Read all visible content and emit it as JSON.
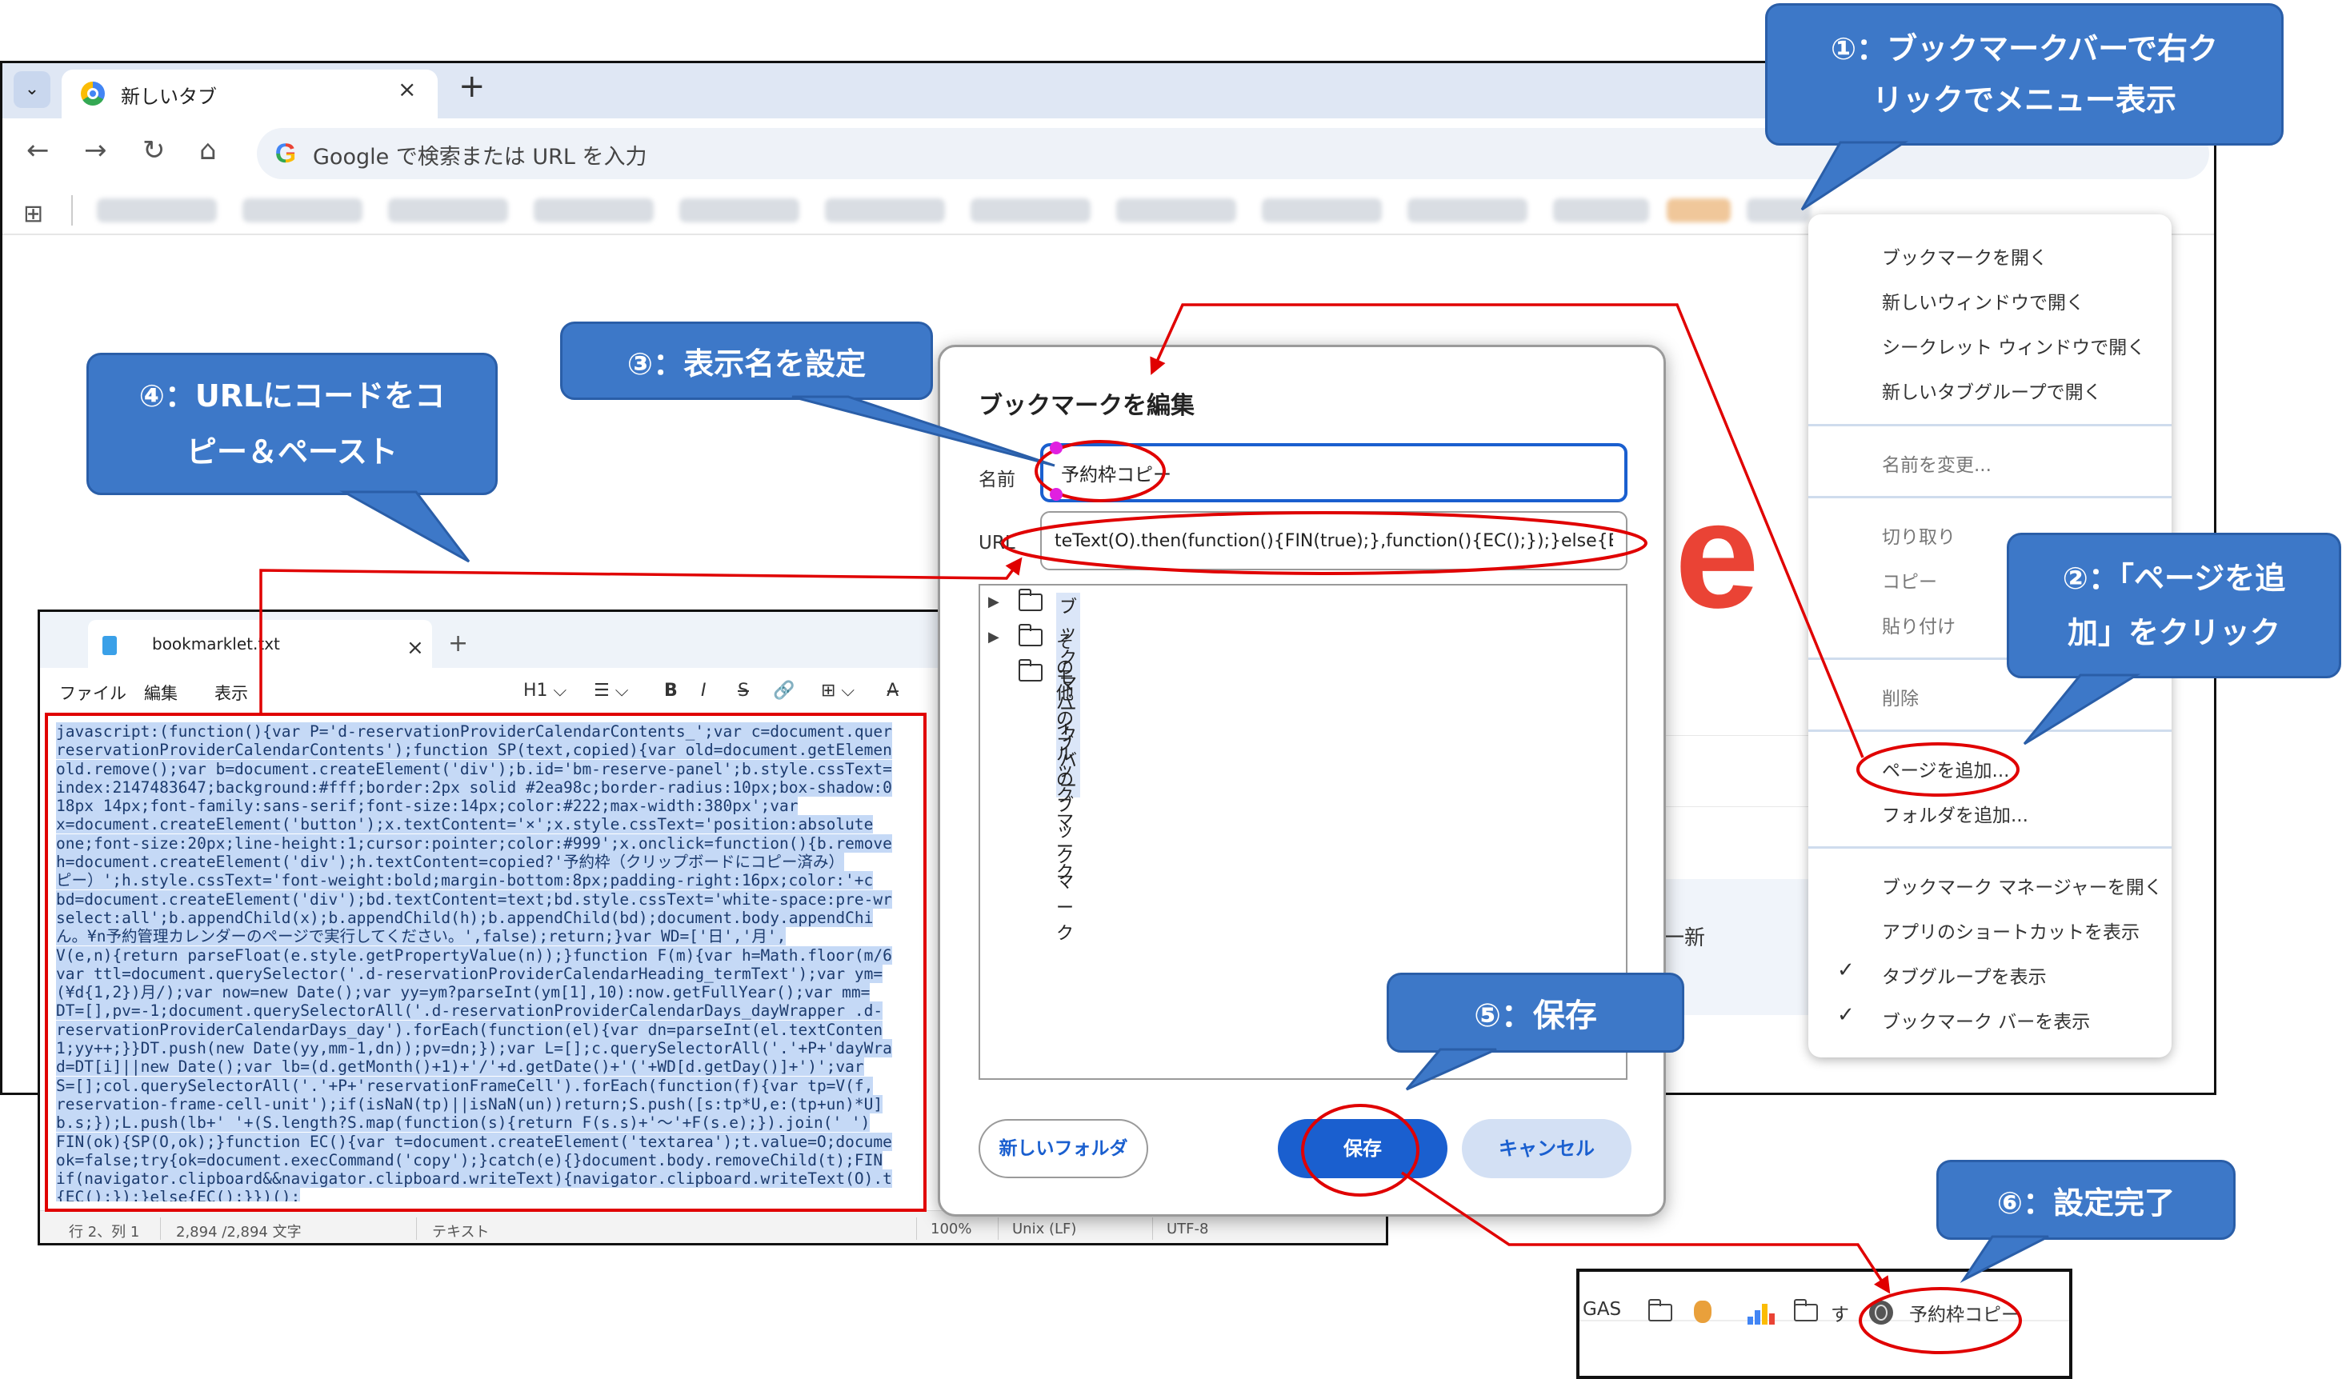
{
  "browser": {
    "tab_title": "新しいタブ",
    "tab_close": "×",
    "new_tab": "+",
    "omnibox_placeholder": "Google で検索または URL を入力",
    "page_partial_text": "を一新"
  },
  "notepad": {
    "tab_title": "bookmarklet.txt",
    "tab_close": "×",
    "new_tab": "+",
    "menu": [
      "ファイル",
      "編集",
      "表示"
    ],
    "toolbar": [
      "H1 ⌵",
      "☰ ⌵",
      "B",
      "I",
      "S",
      "🔗",
      "⊞ ⌵",
      "A̶"
    ],
    "code_lines": [
      "javascript:(function(){var P='d-reservationProviderCalendarContents_';var c=document.quer",
      "reservationProviderCalendarContents');function SP(text,copied){var old=document.getElemen",
      "old.remove();var b=document.createElement('div');b.id='bm-reserve-panel';b.style.cssText=",
      "index:2147483647;background:#fff;border:2px solid #2ea98c;border-radius:10px;box-shadow:0",
      "18px 14px;font-family:sans-serif;font-size:14px;color:#222;max-width:380px';var",
      "x=document.createElement('button');x.textContent='×';x.style.cssText='position:absolute",
      "one;font-size:20px;line-height:1;cursor:pointer;color:#999';x.onclick=function(){b.remove",
      "h=document.createElement('div');h.textContent=copied?'予約枠（クリップボードにコピー済み）",
      "ピー）';h.style.cssText='font-weight:bold;margin-bottom:8px;padding-right:16px;color:'+c",
      "bd=document.createElement('div');bd.textContent=text;bd.style.cssText='white-space:pre-wr",
      "select:all';b.appendChild(x);b.appendChild(h);b.appendChild(bd);document.body.appendChi",
      "ん。¥n予約管理カレンダーのページで実行してください。',false);return;}var WD=['日','月',",
      "V(e,n){return parseFloat(e.style.getPropertyValue(n));}function F(m){var h=Math.floor(m/6",
      "var ttl=document.querySelector('.d-reservationProviderCalendarHeading_termText');var ym=",
      "(¥d{1,2})月/);var now=new Date();var yy=ym?parseInt(ym[1],10):now.getFullYear();var mm=",
      "DT=[],pv=-1;document.querySelectorAll('.d-reservationProviderCalendarDays_dayWrapper .d-",
      "reservationProviderCalendarDays_day').forEach(function(el){var dn=parseInt(el.textConten",
      "1;yy++;}}DT.push(new Date(yy,mm-1,dn));pv=dn;});var L=[];c.querySelectorAll('.'+P+'dayWra",
      "d=DT[i]||new Date();var lb=(d.getMonth()+1)+'/'+d.getDate()+'('+WD[d.getDay()]+')';var",
      "S=[];col.querySelectorAll('.'+P+'reservationFrameCell').forEach(function(f){var tp=V(f,",
      "reservation-frame-cell-unit');if(isNaN(tp)||isNaN(un))return;S.push([s:tp*U,e:(tp+un)*U]",
      "b.s;});L.push(lb+' '+(S.length?S.map(function(s){return F(s.s)+'〜'+F(s.e);}).join(' ')",
      "FIN(ok){SP(O,ok);}function EC(){var t=document.createElement('textarea');t.value=O;docume",
      "ok=false;try{ok=document.execCommand('copy');}catch(e){}document.body.removeChild(t);FIN",
      "if(navigator.clipboard&&navigator.clipboard.writeText){navigator.clipboard.writeText(O).t",
      "{EC();});}else{EC();}})();"
    ],
    "status": {
      "position": "行 2、列 1",
      "chars": "2,894 /2,894 文字",
      "format": "テキスト",
      "zoom": "100%",
      "line_ending": "Unix (LF)",
      "encoding": "UTF-8"
    }
  },
  "dialog": {
    "title": "ブックマークを編集",
    "name_label": "名前",
    "name_value": "予約枠コピー",
    "url_label": "URL",
    "url_value": "teText(O).then(function(){FIN(true);},function(){EC();});}else{EC();}})();",
    "folders": [
      "ブックマーク バー",
      "その他のブックマーク",
      "モバイルのブックマーク"
    ],
    "new_folder_button": "新しいフォルダ",
    "save_button": "保存",
    "cancel_button": "キャンセル"
  },
  "context_menu": {
    "items": [
      "ブックマークを開く",
      "新しいウィンドウで開く",
      "シークレット ウィンドウで開く",
      "新しいタブグループで開く",
      "名前を変更...",
      "切り取り",
      "コピー",
      "貼り付け",
      "削除",
      "ページを追加...",
      "フォルダを追加...",
      "ブックマーク マネージャーを開く",
      "アプリのショートカットを表示",
      "タブグループを表示",
      "ブックマーク バーを表示"
    ],
    "check": "✓"
  },
  "bottom_bookmark_bar": {
    "gas_label": "GAS",
    "su_label": "す",
    "new_bookmark": "予約枠コピー"
  },
  "callouts": {
    "c1": "①：ブックマークバーで右ク\nリックでメニュー表示",
    "c2": "②：「ページを追\n加」をクリック",
    "c3": "③：表示名を設定",
    "c4": "④：URLにコードをコ\nピー＆ペースト",
    "c5": "⑤：保存",
    "c6": "⑥：設定完了"
  },
  "colors": {
    "callout_fill": "#3d78c8",
    "annotation_red": "#e00000",
    "accent_blue": "#1a5fcf"
  }
}
